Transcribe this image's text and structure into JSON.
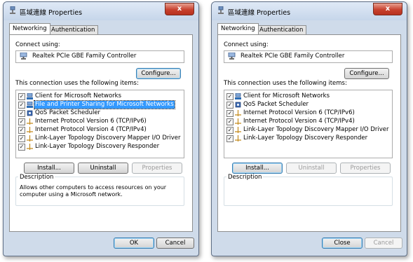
{
  "windows": [
    {
      "title": "區域連線 Properties",
      "close_symbol": "x",
      "tabs": [
        "Networking",
        "Authentication"
      ],
      "connect_using_label": "Connect using:",
      "adapter_name": "Realtek PCIe GBE Family Controller",
      "configure_label": "Configure...",
      "items_label": "This connection uses the following items:",
      "items": [
        {
          "label": "Client for Microsoft Networks",
          "checked": true,
          "icon": "network-client-icon"
        },
        {
          "label": "File and Printer Sharing for Microsoft Networks",
          "checked": true,
          "icon": "file-printer-sharing-icon",
          "selected": true
        },
        {
          "label": "QoS Packet Scheduler",
          "checked": true,
          "icon": "service-icon"
        },
        {
          "label": "Internet Protocol Version 6 (TCP/IPv6)",
          "checked": true,
          "icon": "protocol-icon"
        },
        {
          "label": "Internet Protocol Version 4 (TCP/IPv4)",
          "checked": true,
          "icon": "protocol-icon"
        },
        {
          "label": "Link-Layer Topology Discovery Mapper I/O Driver",
          "checked": true,
          "icon": "protocol-icon"
        },
        {
          "label": "Link-Layer Topology Discovery Responder",
          "checked": true,
          "icon": "protocol-icon"
        }
      ],
      "install_label": "Install...",
      "uninstall_label": "Uninstall",
      "properties_label": "Properties",
      "description_label": "Description",
      "description_text": "Allows other computers to access resources on your computer using a Microsoft network.",
      "ok_label": "OK",
      "cancel_label": "Cancel"
    },
    {
      "title": "區域連線 Properties",
      "close_symbol": "x",
      "tabs": [
        "Networking",
        "Authentication"
      ],
      "connect_using_label": "Connect using:",
      "adapter_name": "Realtek PCIe GBE Family Controller",
      "configure_label": "Configure...",
      "items_label": "This connection uses the following items:",
      "items": [
        {
          "label": "Client for Microsoft Networks",
          "checked": true,
          "icon": "network-client-icon"
        },
        {
          "label": "QoS Packet Scheduler",
          "checked": true,
          "icon": "service-icon"
        },
        {
          "label": "Internet Protocol Version 6 (TCP/IPv6)",
          "checked": true,
          "icon": "protocol-icon"
        },
        {
          "label": "Internet Protocol Version 4 (TCP/IPv4)",
          "checked": true,
          "icon": "protocol-icon"
        },
        {
          "label": "Link-Layer Topology Discovery Mapper I/O Driver",
          "checked": true,
          "icon": "protocol-icon"
        },
        {
          "label": "Link-Layer Topology Discovery Responder",
          "checked": true,
          "icon": "protocol-icon"
        }
      ],
      "install_label": "Install...",
      "uninstall_label": "Uninstall",
      "properties_label": "Properties",
      "description_label": "Description",
      "description_text": "",
      "close_label": "Close",
      "cancel_label": "Cancel"
    }
  ],
  "colors": {
    "selection": "#3399ff",
    "window_frame": "#cfdbea",
    "close_button": "#c7412e"
  }
}
